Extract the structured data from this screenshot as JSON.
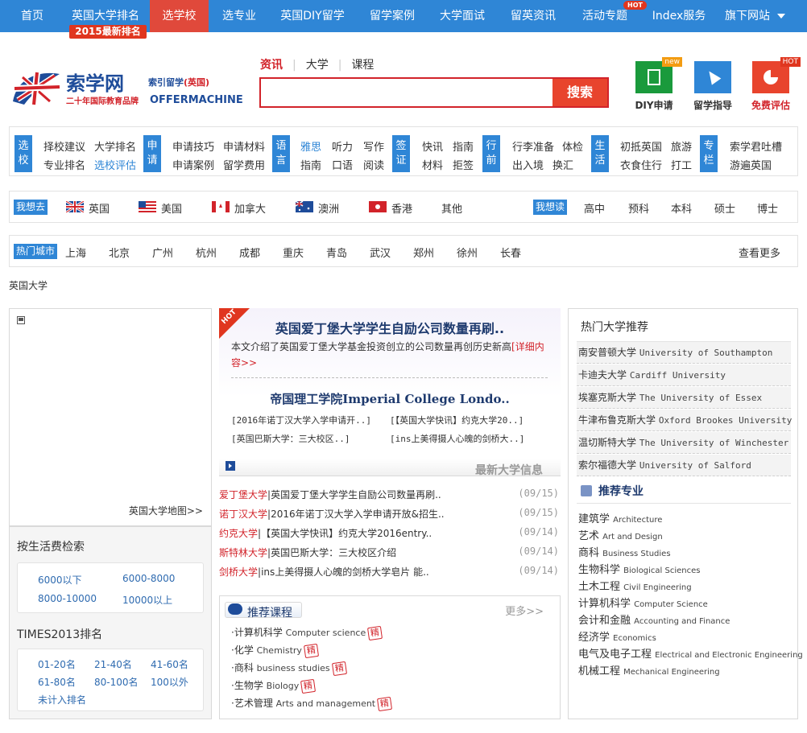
{
  "topnav": {
    "items": [
      "首页",
      "英国大学排名",
      "选学校",
      "选专业",
      "英国DIY留学",
      "留学案例",
      "大学面试",
      "留英资讯",
      "活动专题",
      "Index服务",
      "旗下网站"
    ],
    "badge_2015": "2015最新排名",
    "hot_label": "HOT"
  },
  "logo": {
    "name": "索学网",
    "sub": "索引留学",
    "sub_country": "(英国)",
    "tagline": "二十年国际教育品牌",
    "en": "OFFERMACHINE"
  },
  "search": {
    "tabs": [
      "资讯",
      "大学",
      "课程"
    ],
    "value": "",
    "button": "搜索"
  },
  "quick": [
    {
      "label": "DIY申请",
      "tag": "new"
    },
    {
      "label": "留学指导",
      "tag": ""
    },
    {
      "label": "免费评估",
      "tag": "HOT"
    }
  ],
  "catnav": [
    {
      "label": "选校",
      "links": [
        "择校建议",
        "大学排名",
        "专业排名",
        "选校评估"
      ]
    },
    {
      "label": "申请",
      "links": [
        "申请技巧",
        "申请材料",
        "申请案例",
        "留学费用"
      ]
    },
    {
      "label": "语言",
      "links": [
        "雅思",
        "听力",
        "写作",
        "指南",
        "口语",
        "阅读"
      ]
    },
    {
      "label": "签证",
      "links": [
        "快讯",
        "指南",
        "材料",
        "拒签"
      ]
    },
    {
      "label": "行前",
      "links": [
        "行李准备",
        "体检",
        "出入境",
        "换汇"
      ]
    },
    {
      "label": "生活",
      "links": [
        "初抵英国",
        "旅游",
        "衣食住行",
        "打工"
      ]
    },
    {
      "label": "专栏",
      "links": [
        "索学君吐槽",
        "游遍英国"
      ]
    }
  ],
  "countries": {
    "go_label": "我想去",
    "items": [
      "英国",
      "美国",
      "加拿大",
      "澳洲",
      "香港",
      "其他"
    ],
    "read_label": "我想读",
    "levels": [
      "高中",
      "预科",
      "本科",
      "硕士",
      "博士"
    ]
  },
  "cities": {
    "label": "热门城市",
    "items": [
      "上海",
      "北京",
      "广州",
      "杭州",
      "成都",
      "重庆",
      "青岛",
      "武汉",
      "郑州",
      "徐州",
      "长春"
    ],
    "more": "查看更多"
  },
  "breadcrumb": "英国大学",
  "map": {
    "link": "英国大学地图>>"
  },
  "living_cost": {
    "title": "按生活费检索",
    "links": [
      "6000以下",
      "6000-8000",
      "8000-10000",
      "10000以上"
    ]
  },
  "times": {
    "title": "TIMES2013排名",
    "links": [
      "01-20名",
      "21-40名",
      "41-60名",
      "61-80名",
      "80-100名",
      "100以外",
      "未计入排名"
    ]
  },
  "featured": {
    "hot": "HOT",
    "headline1": "英国爱丁堡大学学生自励公司数量再刷..",
    "summary": "本文介绍了英国爱丁堡大学基金投资创立的公司数量再创历史新高",
    "summary_more": "[详细内容>>",
    "headline2": "帝国理工学院Imperial College Londo..",
    "sublinks": [
      "[2016年诺丁汉大学入学申请开..]",
      "[【英国大学快讯】约克大学20..]",
      "[英国巴斯大学：三大校区..]",
      "[ins上美得摄人心魄的剑桥大..]"
    ]
  },
  "news": {
    "title": "最新大学信息",
    "rows": [
      {
        "tag": "爱丁堡大学",
        "text": "英国爱丁堡大学学生自励公司数量再刷..",
        "date": "(09/15)"
      },
      {
        "tag": "诺丁汉大学",
        "text": "2016年诺丁汉大学入学申请开放&招生..",
        "date": "(09/15)"
      },
      {
        "tag": "约克大学",
        "text": "【英国大学快讯】约克大学2016entry..",
        "date": "(09/14)"
      },
      {
        "tag": "斯特林大学",
        "text": "英国巴斯大学：三大校区介绍",
        "date": "(09/14)"
      },
      {
        "tag": "剑桥大学",
        "text": "ins上美得摄人心魄的剑桥大学皂片 能..",
        "date": "(09/14)"
      }
    ]
  },
  "courses": {
    "title": "推荐课程",
    "more": "更多>>",
    "badge": "精",
    "items": [
      {
        "cn": "·计算机科学",
        "en": "Computer science"
      },
      {
        "cn": "·化学",
        "en": "Chemistry"
      },
      {
        "cn": "·商科",
        "en": "business studies"
      },
      {
        "cn": "·生物学",
        "en": "Biology"
      },
      {
        "cn": "·艺术管理",
        "en": "Arts and management"
      }
    ]
  },
  "hot_unis": {
    "title": "热门大学推荐",
    "items": [
      {
        "cn": "南安普顿大学",
        "en": "University of Southampton"
      },
      {
        "cn": "卡迪夫大学",
        "en": "Cardiff University"
      },
      {
        "cn": "埃塞克斯大学",
        "en": "The University of Essex"
      },
      {
        "cn": "牛津布鲁克斯大学",
        "en": "Oxford Brookes University"
      },
      {
        "cn": "温切斯特大学",
        "en": "The University of Winchester"
      },
      {
        "cn": "索尔福德大学",
        "en": "University of Salford"
      }
    ]
  },
  "majors": {
    "title": "推荐专业",
    "items": [
      {
        "cn": "建筑学",
        "en": "Architecture"
      },
      {
        "cn": "艺术",
        "en": "Art and Design"
      },
      {
        "cn": "商科",
        "en": "Business Studies"
      },
      {
        "cn": "生物科学",
        "en": "Biological Sciences"
      },
      {
        "cn": "土木工程",
        "en": "Civil Engineering"
      },
      {
        "cn": "计算机科学",
        "en": "Computer Science"
      },
      {
        "cn": "会计和金融",
        "en": "Accounting and Finance"
      },
      {
        "cn": "经济学",
        "en": "Economics"
      },
      {
        "cn": "电气及电子工程",
        "en": "Electrical and Electronic Engineering"
      },
      {
        "cn": "机械工程",
        "en": "Mechanical Engineering"
      }
    ]
  },
  "colors": {
    "nav_blue": "#2f86d6",
    "brand_red": "#d2232a",
    "dark_blue": "#1e4c9a"
  }
}
